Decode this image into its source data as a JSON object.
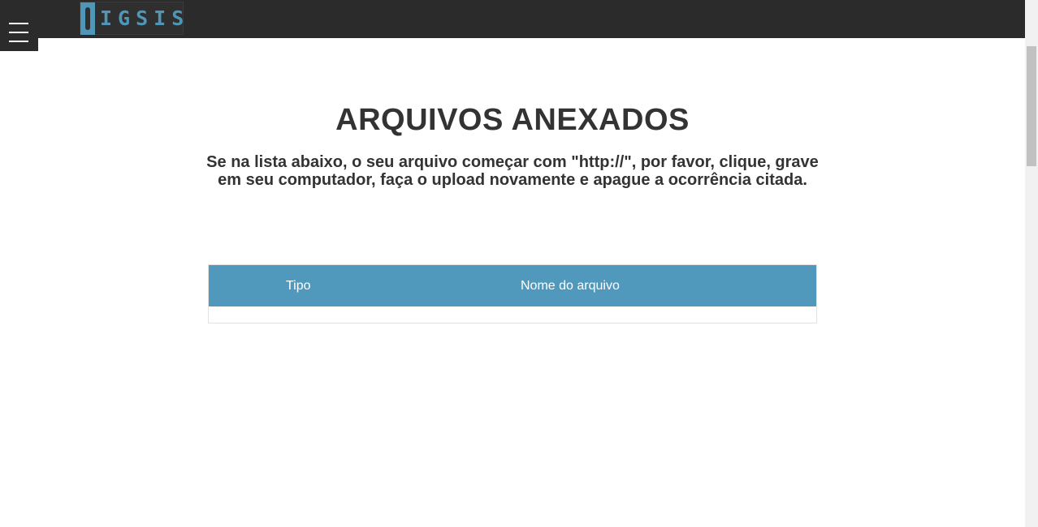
{
  "header": {
    "menu_icon": "hamburger-menu-icon",
    "logo_text": "IGSIS",
    "logo_colors": {
      "mark": "#4f97b9",
      "background": "#2f2f2f"
    },
    "bar_color": "#2b2b2b"
  },
  "main": {
    "title": "ARQUIVOS ANEXADOS",
    "instructions": "Se na lista abaixo, o seu arquivo começar com \"http://\", por favor, clique, grave em seu computador, faça o upload novamente e apague a ocorrência citada."
  },
  "table": {
    "header_color": "#5099bd",
    "columns": [
      "Tipo",
      "Nome do arquivo"
    ],
    "rows": []
  }
}
